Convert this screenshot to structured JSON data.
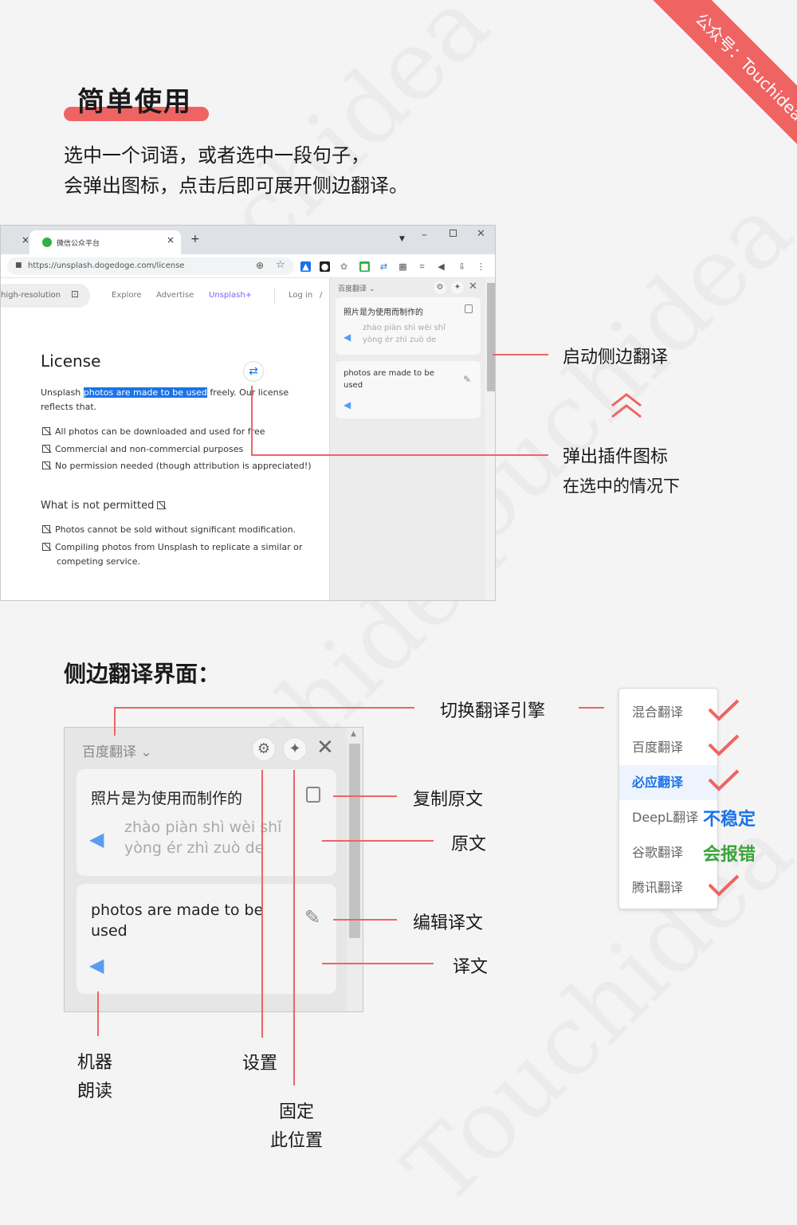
{
  "ribbon": {
    "text": "公众号：Touchidea"
  },
  "watermark": {
    "text": "Touchidea"
  },
  "header": {
    "title": "简单使用",
    "intro_line1": "选中一个词语，或者选中一段句子，",
    "intro_line2": "会弹出图标，点击后即可展开侧边翻译。"
  },
  "browser": {
    "tab1_close": "×",
    "tab2_title": "微信公众平台",
    "tab2_close": "×",
    "new_tab": "+",
    "url": "https://unsplash.dogedoge.com/license",
    "search_placeholder": "high-resolution",
    "nav": {
      "explore": "Explore",
      "advertise": "Advertise",
      "unsplash_plus": "Unsplash+",
      "login": "Log in",
      "slash": "/"
    },
    "license_heading": "License",
    "para_before": "Unsplash ",
    "para_selected": "photos are made to be used",
    "para_after": " freely. Our license",
    "para_line2": "reflects that.",
    "allowed": [
      "All photos can be downloaded and used for free",
      "Commercial and non-commercial purposes",
      "No permission needed (though attribution is appreciated!)"
    ],
    "not_permitted_heading": "What is not permitted",
    "not_permitted": [
      "Photos cannot be sold without significant modification.",
      "Compiling photos from Unsplash to replicate a similar or",
      "competing service."
    ]
  },
  "sidebar": {
    "engine": "百度翻译",
    "source_text": "照片是为使用而制作的",
    "pinyin_line1": "zhào piàn shì wèi shǐ",
    "pinyin_line2": "yòng ér zhì zuò de",
    "translation_line1": "photos are made to be",
    "translation_line2": "used"
  },
  "annotations": {
    "launch_sidebar": "启动侧边翻译",
    "popup_icon_line1": "弹出插件图标",
    "popup_icon_line2": "在选中的情况下",
    "sidebar_ui_title": "侧边翻译界面：",
    "switch_engine": "切换翻译引擎",
    "copy_source": "复制原文",
    "source": "原文",
    "edit_translation": "编辑译文",
    "translation": "译文",
    "tts_line1": "机器",
    "tts_line2": "朗读",
    "settings": "设置",
    "pin_line1": "固定",
    "pin_line2": "此位置"
  },
  "engines": {
    "items": [
      "混合翻译",
      "百度翻译",
      "必应翻译",
      "DeepL翻译",
      "谷歌翻译",
      "腾讯翻译"
    ],
    "selected": "必应翻译",
    "deepl_status": "不稳定",
    "google_status": "会报错",
    "colors": {
      "unstable": "#1a73e8",
      "error": "#3aa53a",
      "check": "#f06363"
    }
  },
  "colors": {
    "accent": "#f06363",
    "link": "#1a73e8",
    "tts": "#5b9cf0"
  }
}
